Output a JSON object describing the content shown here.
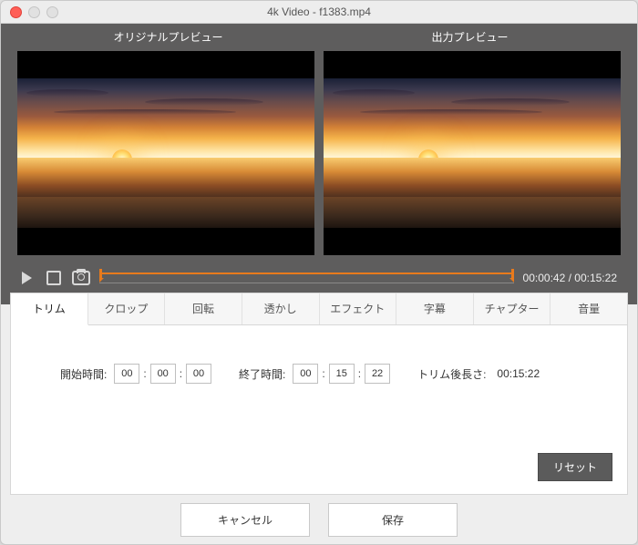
{
  "window": {
    "title": "4k Video - f1383.mp4"
  },
  "preview": {
    "original_label": "オリジナルプレビュー",
    "output_label": "出力プレビュー"
  },
  "transport": {
    "current": "00:00:42",
    "total": "00:15:22"
  },
  "tabs": [
    {
      "id": "trim",
      "label": "トリム",
      "active": true
    },
    {
      "id": "crop",
      "label": "クロップ",
      "active": false
    },
    {
      "id": "rotate",
      "label": "回転",
      "active": false
    },
    {
      "id": "watermark",
      "label": "透かし",
      "active": false
    },
    {
      "id": "effect",
      "label": "エフェクト",
      "active": false
    },
    {
      "id": "subtitle",
      "label": "字幕",
      "active": false
    },
    {
      "id": "chapter",
      "label": "チャプター",
      "active": false
    },
    {
      "id": "volume",
      "label": "音量",
      "active": false
    }
  ],
  "trim": {
    "start_label": "開始時間:",
    "start": {
      "h": "00",
      "m": "00",
      "s": "00"
    },
    "end_label": "終了時間:",
    "end": {
      "h": "00",
      "m": "15",
      "s": "22"
    },
    "length_label": "トリム後長さ:",
    "length_value": "00:15:22",
    "reset": "リセット"
  },
  "footer": {
    "cancel": "キャンセル",
    "save": "保存"
  }
}
